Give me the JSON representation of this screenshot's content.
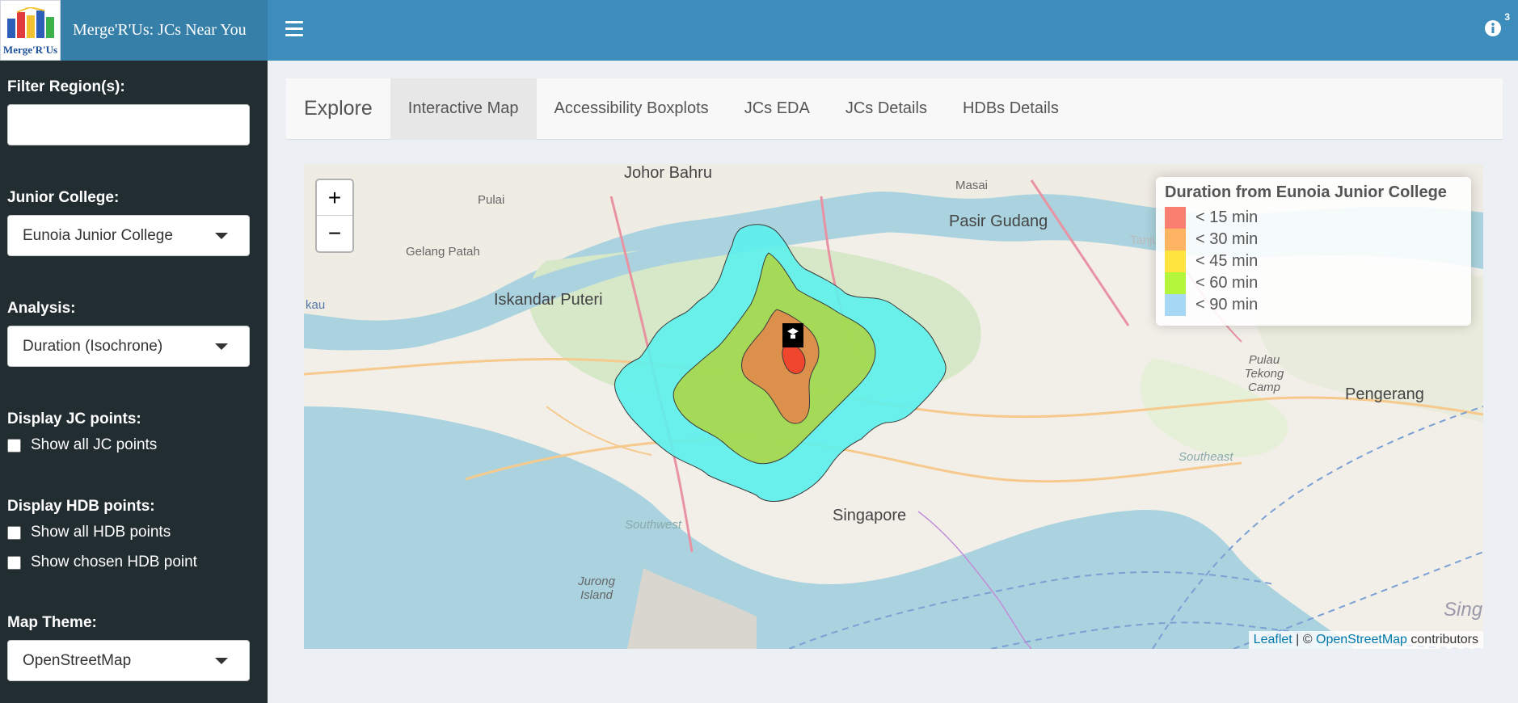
{
  "header": {
    "logo_text": "Merge'R'Us",
    "app_title": "Merge'R'Us: JCs Near You",
    "info_badge": "3"
  },
  "sidebar": {
    "filter_region_label": "Filter Region(s):",
    "filter_region_value": "",
    "junior_college_label": "Junior College:",
    "junior_college_value": "Eunoia Junior College",
    "analysis_label": "Analysis:",
    "analysis_value": "Duration (Isochrone)",
    "display_jc_label": "Display JC points:",
    "show_all_jc": "Show all JC points",
    "display_hdb_label": "Display HDB points:",
    "show_all_hdb": "Show all HDB points",
    "show_chosen_hdb": "Show chosen HDB point",
    "map_theme_label": "Map Theme:",
    "map_theme_value": "OpenStreetMap"
  },
  "panel": {
    "title": "Explore",
    "tabs": [
      {
        "label": "Interactive Map",
        "active": true
      },
      {
        "label": "Accessibility Boxplots",
        "active": false
      },
      {
        "label": "JCs EDA",
        "active": false
      },
      {
        "label": "JCs Details",
        "active": false
      },
      {
        "label": "HDBs Details",
        "active": false
      }
    ]
  },
  "map": {
    "zoom_in": "+",
    "zoom_out": "−",
    "place_labels": {
      "johor_bahru": "Johor Bahru",
      "iskandar_puteri": "Iskandar Puteri",
      "pasir_gudang": "Pasir Gudang",
      "masai": "Masai",
      "gelang_patah": "Gelang Patah",
      "pulai": "Pulai",
      "tanjung_surat": "Tanjung Surat",
      "pulau_tekong": "Pulau Tekong Camp",
      "pengerang": "Pengerang",
      "southeast": "Southeast",
      "southwest": "Southwest",
      "jurong_island": "Jurong Island",
      "singapore": "Singapore",
      "sing": "Sing",
      "kau": "kau"
    },
    "legend": {
      "title": "Duration from Eunoia Junior College",
      "items": [
        {
          "label": "< 15 min",
          "color": "#fb8072"
        },
        {
          "label": "< 30 min",
          "color": "#fdb462"
        },
        {
          "label": "< 45 min",
          "color": "#ffe33f"
        },
        {
          "label": "< 60 min",
          "color": "#b3f63c"
        },
        {
          "label": "< 90 min",
          "color": "#a6d8f6"
        }
      ]
    },
    "attribution": {
      "leaflet": "Leaflet",
      "separator": " | © ",
      "osm": "OpenStreetMap",
      "suffix": " contributors"
    },
    "isochrone_colors": {
      "lt90": "#5ef0ec",
      "lt60": "#a9d84a",
      "lt45": "#c9c43a",
      "lt30": "#e08b4b",
      "lt15": "#f2402a"
    }
  }
}
